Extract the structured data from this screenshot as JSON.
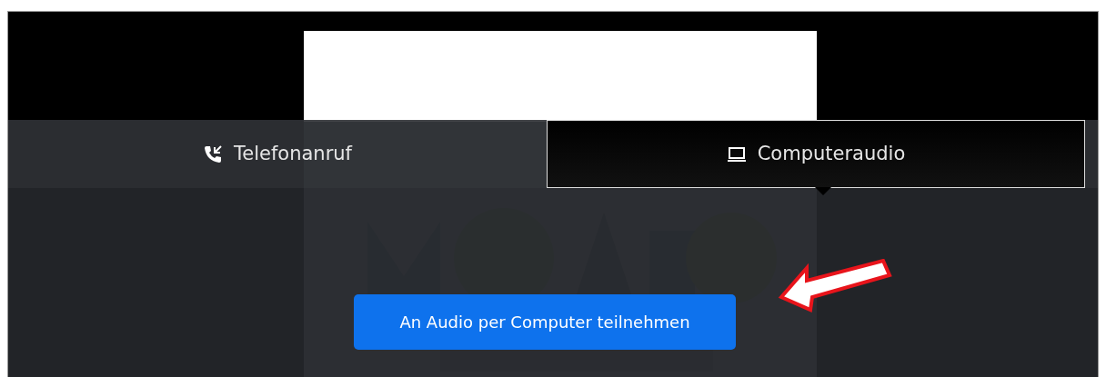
{
  "audio_tabs": [
    {
      "label": "Telefonanruf",
      "kind": "phone",
      "selected": false
    },
    {
      "label": "Computeraudio",
      "kind": "computer",
      "selected": true
    }
  ],
  "join_button": {
    "label": "An Audio per Computer teilnehmen"
  }
}
